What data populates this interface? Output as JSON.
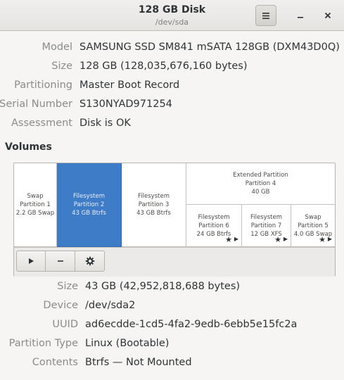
{
  "window": {
    "title": "128 GB Disk",
    "subtitle": "/dev/sda",
    "menu_icon": "hamburger-icon",
    "minimize_icon": "minimize-icon",
    "close_icon": "close-icon"
  },
  "disk": [
    {
      "label": "Model",
      "value": "SAMSUNG SSD SM841 mSATA 128GB (DXM43D0Q)"
    },
    {
      "label": "Size",
      "value": "128 GB (128,035,676,160 bytes)"
    },
    {
      "label": "Partitioning",
      "value": "Master Boot Record"
    },
    {
      "label": "Serial Number",
      "value": "S130NYAD971254"
    },
    {
      "label": "Assessment",
      "value": "Disk is OK"
    }
  ],
  "volumes_heading": "Volumes",
  "partitions": {
    "p1": {
      "l1": "Swap",
      "l2": "Partition 1",
      "l3": "2.2 GB Swap"
    },
    "p2": {
      "l1": "Filesystem",
      "l2": "Partition 2",
      "l3": "43 GB Btrfs"
    },
    "p3": {
      "l1": "Filesystem",
      "l2": "Partition 3",
      "l3": "43 GB Btrfs"
    },
    "p4": {
      "l1": "Extended Partition",
      "l2": "Partition 4",
      "l3": "40 GB"
    },
    "p6": {
      "l1": "Filesystem",
      "l2": "Partition 6",
      "l3": "24 GB Btrfs"
    },
    "p7": {
      "l1": "Filesystem",
      "l2": "Partition 7",
      "l3": "12 GB XFS"
    },
    "p5": {
      "l1": "Swap",
      "l2": "Partition 5",
      "l3": "4.0 GB Swap"
    }
  },
  "toolbar": {
    "mount_icon": "play-icon",
    "delete_icon": "minus-icon",
    "settings_icon": "gear-icon"
  },
  "selected": [
    {
      "label": "Size",
      "value": "43 GB (42,952,818,688 bytes)"
    },
    {
      "label": "Device",
      "value": "/dev/sda2"
    },
    {
      "label": "UUID",
      "value": "ad6ecdde-1cd5-4fa2-9edb-6ebb5e15fc2a"
    },
    {
      "label": "Partition Type",
      "value": "Linux (Bootable)"
    },
    {
      "label": "Contents",
      "value": "Btrfs — Not Mounted"
    }
  ],
  "colors": {
    "selection": "#3f7cc8",
    "label": "#8a8c87",
    "text": "#2e3436"
  }
}
